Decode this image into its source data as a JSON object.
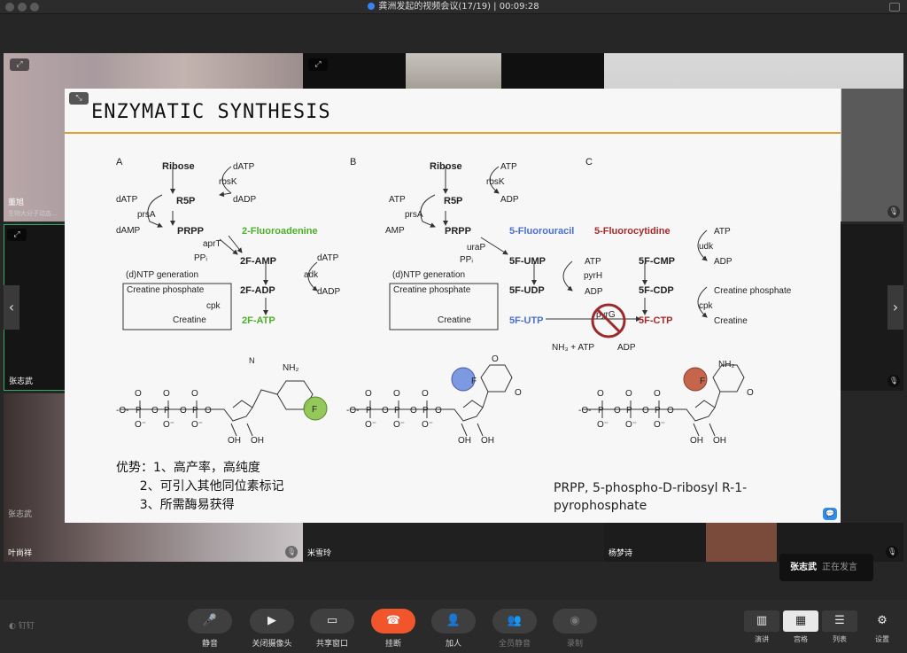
{
  "window": {
    "title": "龚洲发起的视频会议(17/19) | 00:09:28"
  },
  "participants": {
    "t1": "董旭",
    "t1sub": "生物大分子动态...",
    "t5": "张志武",
    "t6": "张志武",
    "t7": "叶尚祥",
    "t8": "米雪玲",
    "t9": "杨梦诗"
  },
  "slide": {
    "title": "ENZYMATIC SYNTHESIS",
    "panels": {
      "a": "A",
      "b": "B",
      "c": "C"
    },
    "advantages": {
      "l1": "优势：1、高产率，高纯度",
      "l2": "      2、可引入其他同位素标记",
      "l3": "      3、所需酶易获得"
    },
    "footnote": "PRPP, 5-phospho-D-ribosyl R-1-pyrophosphate",
    "colors": {
      "green": "#4caf2a",
      "blue": "#4a6fd0",
      "red": "#a52a2a"
    }
  },
  "speaker": {
    "name": "张志武",
    "status": "正在发言"
  },
  "toolbar": {
    "mute": "静音",
    "camera": "关闭摄像头",
    "share": "共享窗口",
    "hangup": "挂断",
    "join": "加人",
    "muteall": "全员静音",
    "record": "录制"
  },
  "views": {
    "speaker": "演讲",
    "grid": "宫格",
    "list": "列表",
    "settings": "设置"
  },
  "brand": "钉钉"
}
